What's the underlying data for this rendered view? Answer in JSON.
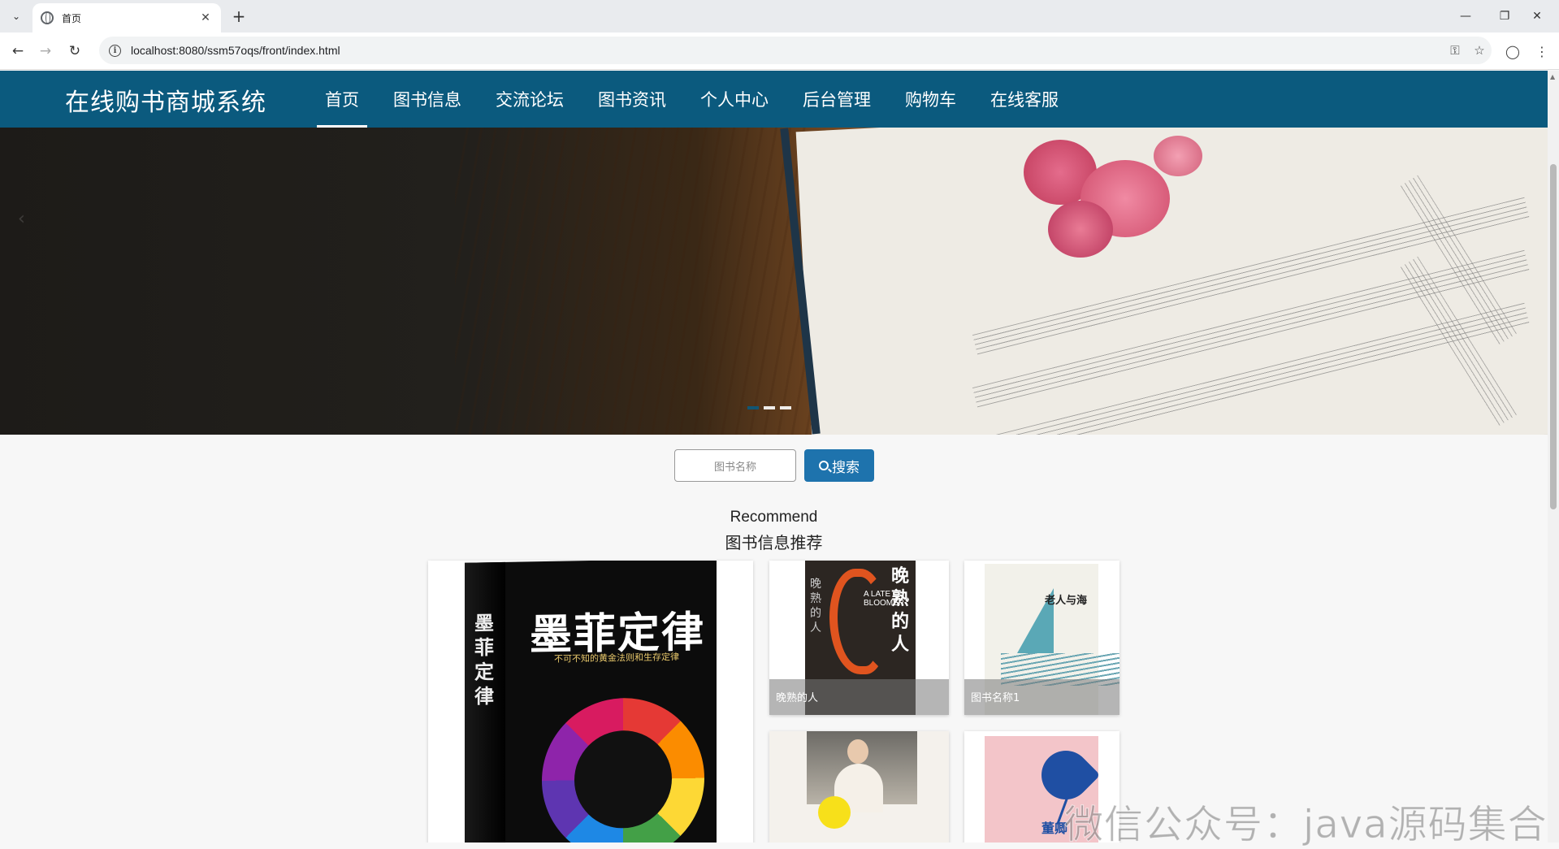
{
  "browser": {
    "tab_title": "首页",
    "url": "localhost:8080/ssm57oqs/front/index.html",
    "new_tab": "+",
    "minimize": "—",
    "restore": "❐",
    "close": "✕"
  },
  "site": {
    "title": "在线购书商城系统",
    "menu": [
      {
        "label": "首页",
        "active": true
      },
      {
        "label": "图书信息"
      },
      {
        "label": "交流论坛"
      },
      {
        "label": "图书资讯"
      },
      {
        "label": "个人中心"
      },
      {
        "label": "后台管理"
      },
      {
        "label": "购物车"
      },
      {
        "label": "在线客服"
      }
    ]
  },
  "carousel": {
    "slide_count": 3,
    "active_index": 0
  },
  "search": {
    "placeholder": "图书名称",
    "button_label": "搜索"
  },
  "recommend": {
    "title_en": "Recommend",
    "title_zh": "图书信息推荐",
    "books": [
      {
        "name": "",
        "cover_title": "墨菲定律",
        "cover_subtitle": "不可不知的黄金法则和生存定律",
        "spine_text": "墨菲定律"
      },
      {
        "name": "晚熟的人",
        "cover_title": "晚熟的人",
        "cover_en": "A LATE BLOOMER",
        "spine_text": "晚熟的人"
      },
      {
        "name": "图书名称1",
        "cover_title": "老人与海"
      },
      {
        "name": ""
      },
      {
        "name": "",
        "cover_title": "董卿"
      }
    ]
  },
  "watermark": "微信公众号：java源码集合"
}
